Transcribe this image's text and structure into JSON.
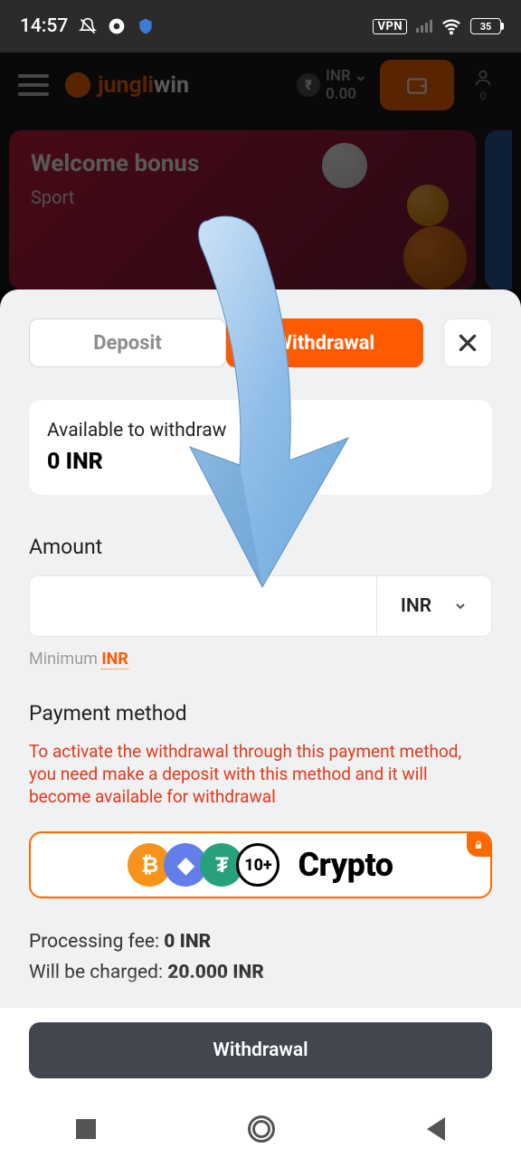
{
  "status": {
    "time": "14:57",
    "vpn": "VPN",
    "battery": "35"
  },
  "header": {
    "logo1": "jungli",
    "logo2": "win",
    "currency": "INR",
    "balance": "0.00",
    "notif_count": "0"
  },
  "banner": {
    "title": "Welcome bonus",
    "subtitle": "Sport"
  },
  "sheet": {
    "tabs": {
      "deposit": "Deposit",
      "withdrawal": "Withdrawal"
    },
    "available_label": "Available to withdraw",
    "available_value": "0 INR",
    "amount_label": "Amount",
    "currency": "INR",
    "minimum_prefix": "Minimum ",
    "minimum_currency": "INR",
    "payment_method_label": "Payment method",
    "warning": "To activate the withdrawal through this payment method, you need make a deposit with this method and it will become available for withdrawal",
    "method": {
      "name": "Crypto",
      "more": "10+"
    },
    "fee_label": "Processing fee: ",
    "fee_value": "0 INR",
    "charge_label": "Will be charged: ",
    "charge_value": "20.000 INR",
    "submit": "Withdrawal"
  }
}
